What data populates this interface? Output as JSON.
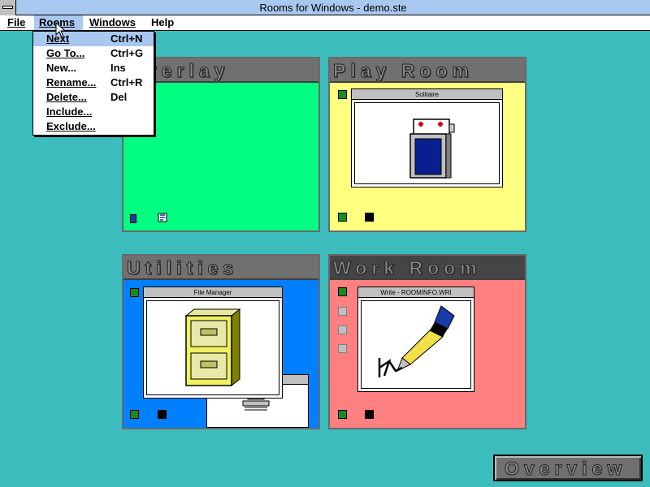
{
  "window": {
    "title": "Rooms for Windows - demo.ste"
  },
  "menubar": {
    "items": [
      "File",
      "Rooms",
      "Windows",
      "Help"
    ],
    "active": "Rooms"
  },
  "rooms_menu": {
    "items": [
      {
        "label": "Next",
        "accel": "Ctrl+N",
        "highlighted": true
      },
      {
        "label": "Go To...",
        "accel": "Ctrl+G"
      },
      {
        "label": "New...",
        "accel": "Ins"
      },
      {
        "label": "Rename...",
        "accel": "Ctrl+R"
      },
      {
        "label": "Delete...",
        "accel": "Del"
      },
      {
        "label": "Include...",
        "accel": ""
      },
      {
        "label": "Exclude...",
        "accel": ""
      }
    ]
  },
  "rooms": [
    {
      "title": "Overlay",
      "bg": "#00ff80",
      "windows": []
    },
    {
      "title": "Play Room",
      "bg": "#ffff80",
      "windows": [
        {
          "title": "Solitaire"
        }
      ]
    },
    {
      "title": "Utilities",
      "bg": "#0080ff",
      "windows": [
        {
          "title": "File Manager"
        }
      ]
    },
    {
      "title": "Work Room",
      "bg": "#ff8080",
      "windows": [
        {
          "title": "Write - ROOMINFO.WRI"
        }
      ]
    }
  ],
  "overview_button": {
    "label": "Overview"
  },
  "colors": {
    "desktop": "#3cbcbc",
    "titlebar": "#a9c8ef",
    "highlight": "#a9c8ef"
  }
}
